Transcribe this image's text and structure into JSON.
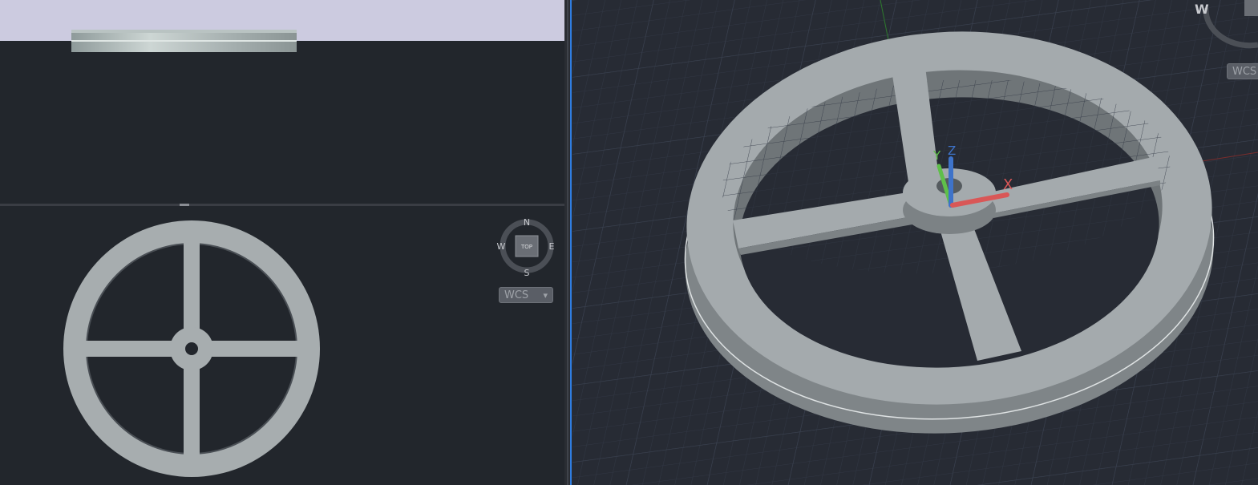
{
  "viewports": {
    "front": {
      "name": "front-view"
    },
    "top": {
      "name": "top-view",
      "viewcube": {
        "face_label": "TOP",
        "north": "N",
        "south": "S",
        "east": "E",
        "west": "W"
      },
      "ucs_menu": {
        "label": "WCS",
        "arrow": "▾"
      }
    },
    "iso": {
      "name": "isometric-view",
      "viewcube": {
        "west": "W"
      },
      "ucs_menu": {
        "label": "WCS"
      },
      "ucs_icon": {
        "x_label": "X",
        "y_label": "Y",
        "z_label": "Z"
      }
    }
  },
  "colors": {
    "viewport_bg": "#22262c",
    "iso_bg": "#272b34",
    "sky": "#cccbe0",
    "model_gray": "#a7adaf",
    "model_dark": "#858b8e",
    "active_border": "#2f7de1",
    "axis_x": "#d95757",
    "axis_y": "#5fbf4a",
    "axis_z": "#3e73c9"
  }
}
